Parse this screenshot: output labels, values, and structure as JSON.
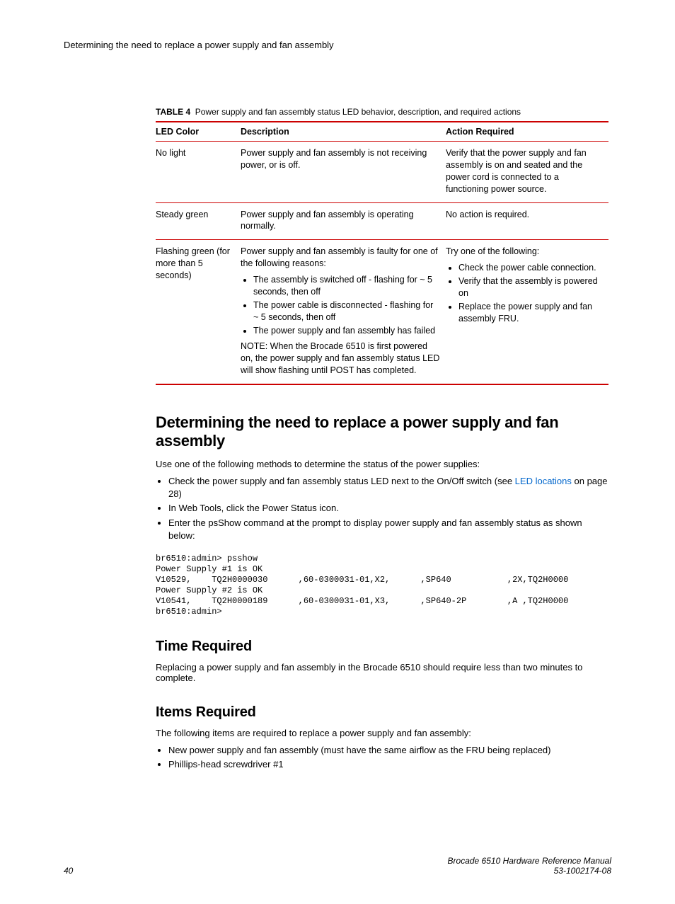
{
  "running_head": "Determining the need to replace a power supply and fan assembly",
  "table": {
    "caption_label": "TABLE 4",
    "caption_text": "Power supply and fan assembly status LED behavior, description, and required actions",
    "headers": {
      "c1": "LED Color",
      "c2": "Description",
      "c3": "Action Required"
    },
    "rows": [
      {
        "led": "No light",
        "desc": "Power supply and fan assembly is not receiving power, or is off.",
        "action": "Verify that the power supply and fan assembly is on and seated and the power cord is connected to a functioning power source."
      },
      {
        "led": "Steady green",
        "desc": "Power supply and fan assembly is operating normally.",
        "action": "No action is required."
      },
      {
        "led": "Flashing green (for more than 5 seconds)",
        "desc_intro": "Power supply and fan assembly is faulty for one of the following reasons:",
        "desc_items": [
          "The assembly is switched off - flashing for ~ 5 seconds, then off",
          "The power cable is disconnected - flashing for ~ 5 seconds, then off",
          "The power supply and fan assembly has failed"
        ],
        "desc_note": "NOTE: When the Brocade 6510 is first powered on, the power supply and fan assembly status LED will show flashing until POST has completed.",
        "action_intro": "Try one of the following:",
        "action_items": [
          "Check the power cable connection.",
          "Verify that the assembly is powered on",
          "Replace the power supply and fan assembly FRU."
        ]
      }
    ]
  },
  "section1": {
    "heading": "Determining the need to replace a power supply and fan assembly",
    "intro": "Use one of the following methods to determine the status of the power supplies:",
    "items": {
      "i1_pre": "Check the power supply and fan assembly status LED next to the On/Off switch (see ",
      "i1_link": "LED locations",
      "i1_post": " on page 28)",
      "i2": "In Web Tools, click the Power Status icon.",
      "i3": "Enter the psShow command at the prompt to display power supply and fan assembly status as shown below:"
    },
    "code": "br6510:admin> psshow\nPower Supply #1 is OK\nV10529,    TQ2H0000030      ,60-0300031-01,X2,      ,SP640           ,2X,TQ2H0000\nPower Supply #2 is OK\nV10541,    TQ2H0000189      ,60-0300031-01,X3,      ,SP640-2P        ,A ,TQ2H0000\nbr6510:admin>"
  },
  "section2": {
    "heading": "Time Required",
    "body": "Replacing a power supply and fan assembly in the Brocade 6510 should require less than two minutes to complete."
  },
  "section3": {
    "heading": "Items Required",
    "intro": "The following items are required to replace a power supply and fan assembly:",
    "items": [
      "New power supply and fan assembly (must have the same airflow as the FRU being replaced)",
      "Phillips-head screwdriver #1"
    ]
  },
  "footer": {
    "page": "40",
    "title": "Brocade 6510 Hardware Reference Manual",
    "docnum": "53-1002174-08"
  }
}
